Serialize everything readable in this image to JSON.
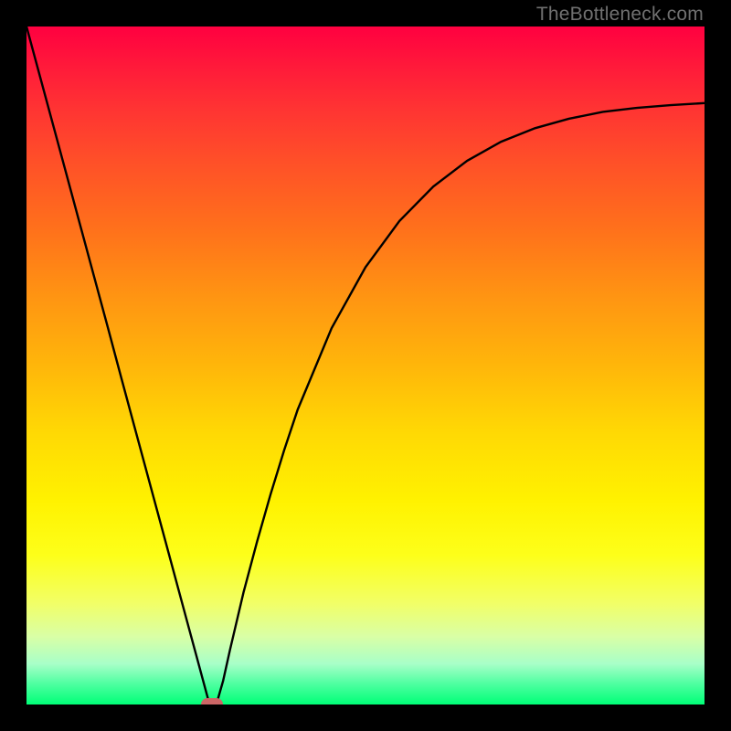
{
  "watermark": "TheBottleneck.com",
  "colors": {
    "frame": "#000000",
    "curve": "#000000",
    "marker": "#cc6666"
  },
  "chart_data": {
    "type": "line",
    "title": "",
    "xlabel": "",
    "ylabel": "",
    "xlim": [
      0,
      100
    ],
    "ylim": [
      0,
      100
    ],
    "grid": false,
    "legend": false,
    "series": [
      {
        "name": "bottleneck-curve",
        "x": [
          0,
          2,
          4,
          6,
          8,
          10,
          12,
          14,
          16,
          18,
          20,
          22,
          24,
          25,
          26,
          27,
          28,
          29,
          30,
          32,
          34,
          36,
          38,
          40,
          45,
          50,
          55,
          60,
          65,
          70,
          75,
          80,
          85,
          90,
          95,
          100
        ],
        "values": [
          100,
          92.6,
          85.2,
          77.8,
          70.4,
          63.0,
          55.6,
          48.1,
          40.7,
          33.3,
          25.9,
          18.5,
          11.1,
          7.4,
          3.7,
          0.0,
          0.0,
          3.5,
          8.0,
          16.5,
          24.0,
          31.0,
          37.5,
          43.5,
          55.5,
          64.5,
          71.3,
          76.4,
          80.2,
          83.0,
          85.0,
          86.4,
          87.4,
          88.0,
          88.4,
          88.7
        ]
      }
    ],
    "annotations": [
      {
        "name": "minimum-marker",
        "x": 27.3,
        "y": 0.0
      }
    ]
  }
}
